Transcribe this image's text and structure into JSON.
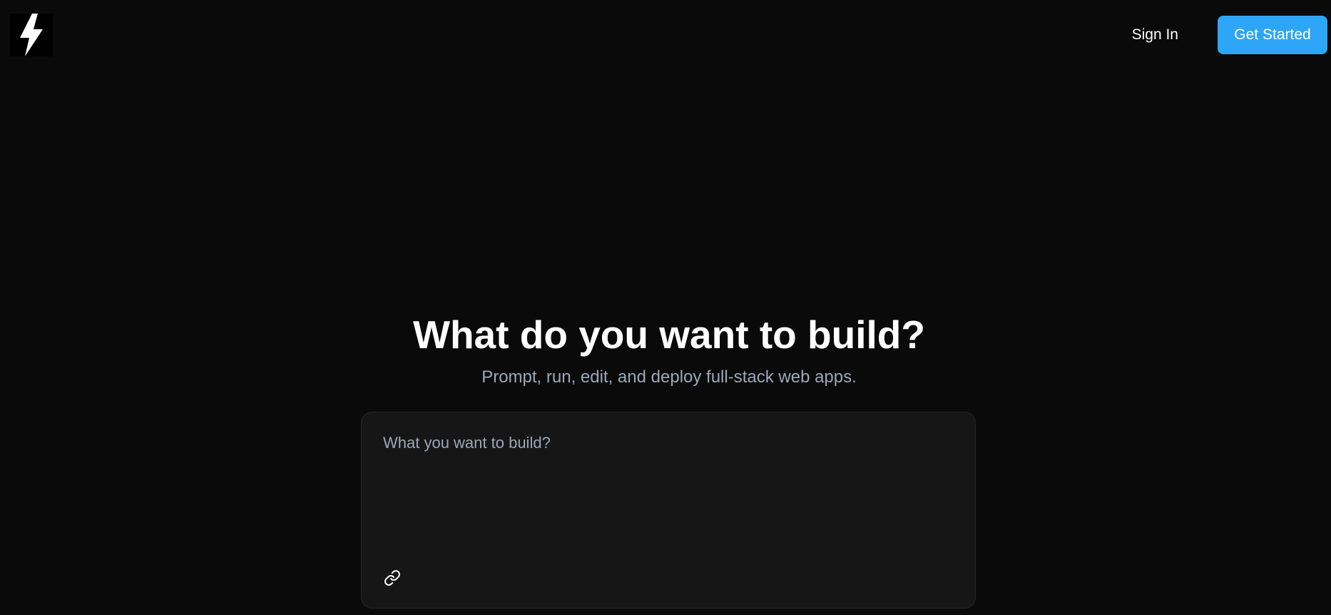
{
  "header": {
    "logo_icon": "lightning-bolt-icon",
    "sign_in_label": "Sign In",
    "get_started_label": "Get Started",
    "accent_color": "#2ea6f8"
  },
  "hero": {
    "title": "What do you want to build?",
    "subtitle": "Prompt, run, edit, and deploy full-stack web apps."
  },
  "prompt": {
    "placeholder": "What you want to build?",
    "value": "",
    "attach_icon": "link-icon"
  }
}
